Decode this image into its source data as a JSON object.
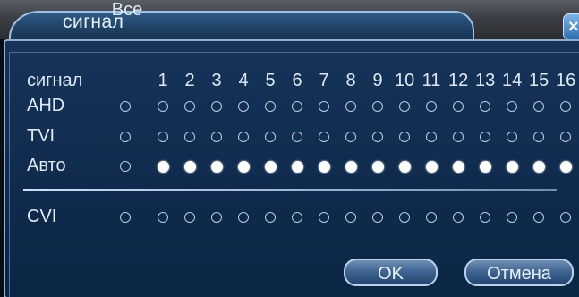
{
  "dialog": {
    "title": "сигнал",
    "close_icon": "close-icon"
  },
  "header": {
    "row_label": "сигнал",
    "all_label": "Все",
    "channels": [
      "1",
      "2",
      "3",
      "4",
      "5",
      "6",
      "7",
      "8",
      "9",
      "10",
      "11",
      "12",
      "13",
      "14",
      "15",
      "16"
    ]
  },
  "rows": [
    {
      "label": "AHD",
      "all_selected": false,
      "channels_selected": false
    },
    {
      "label": "TVI",
      "all_selected": false,
      "channels_selected": false
    },
    {
      "label": "Авто",
      "all_selected": false,
      "channels_selected": true
    },
    {
      "label": "CVI",
      "all_selected": false,
      "channels_selected": false
    }
  ],
  "buttons": {
    "ok": "OK",
    "cancel": "Отмена"
  }
}
